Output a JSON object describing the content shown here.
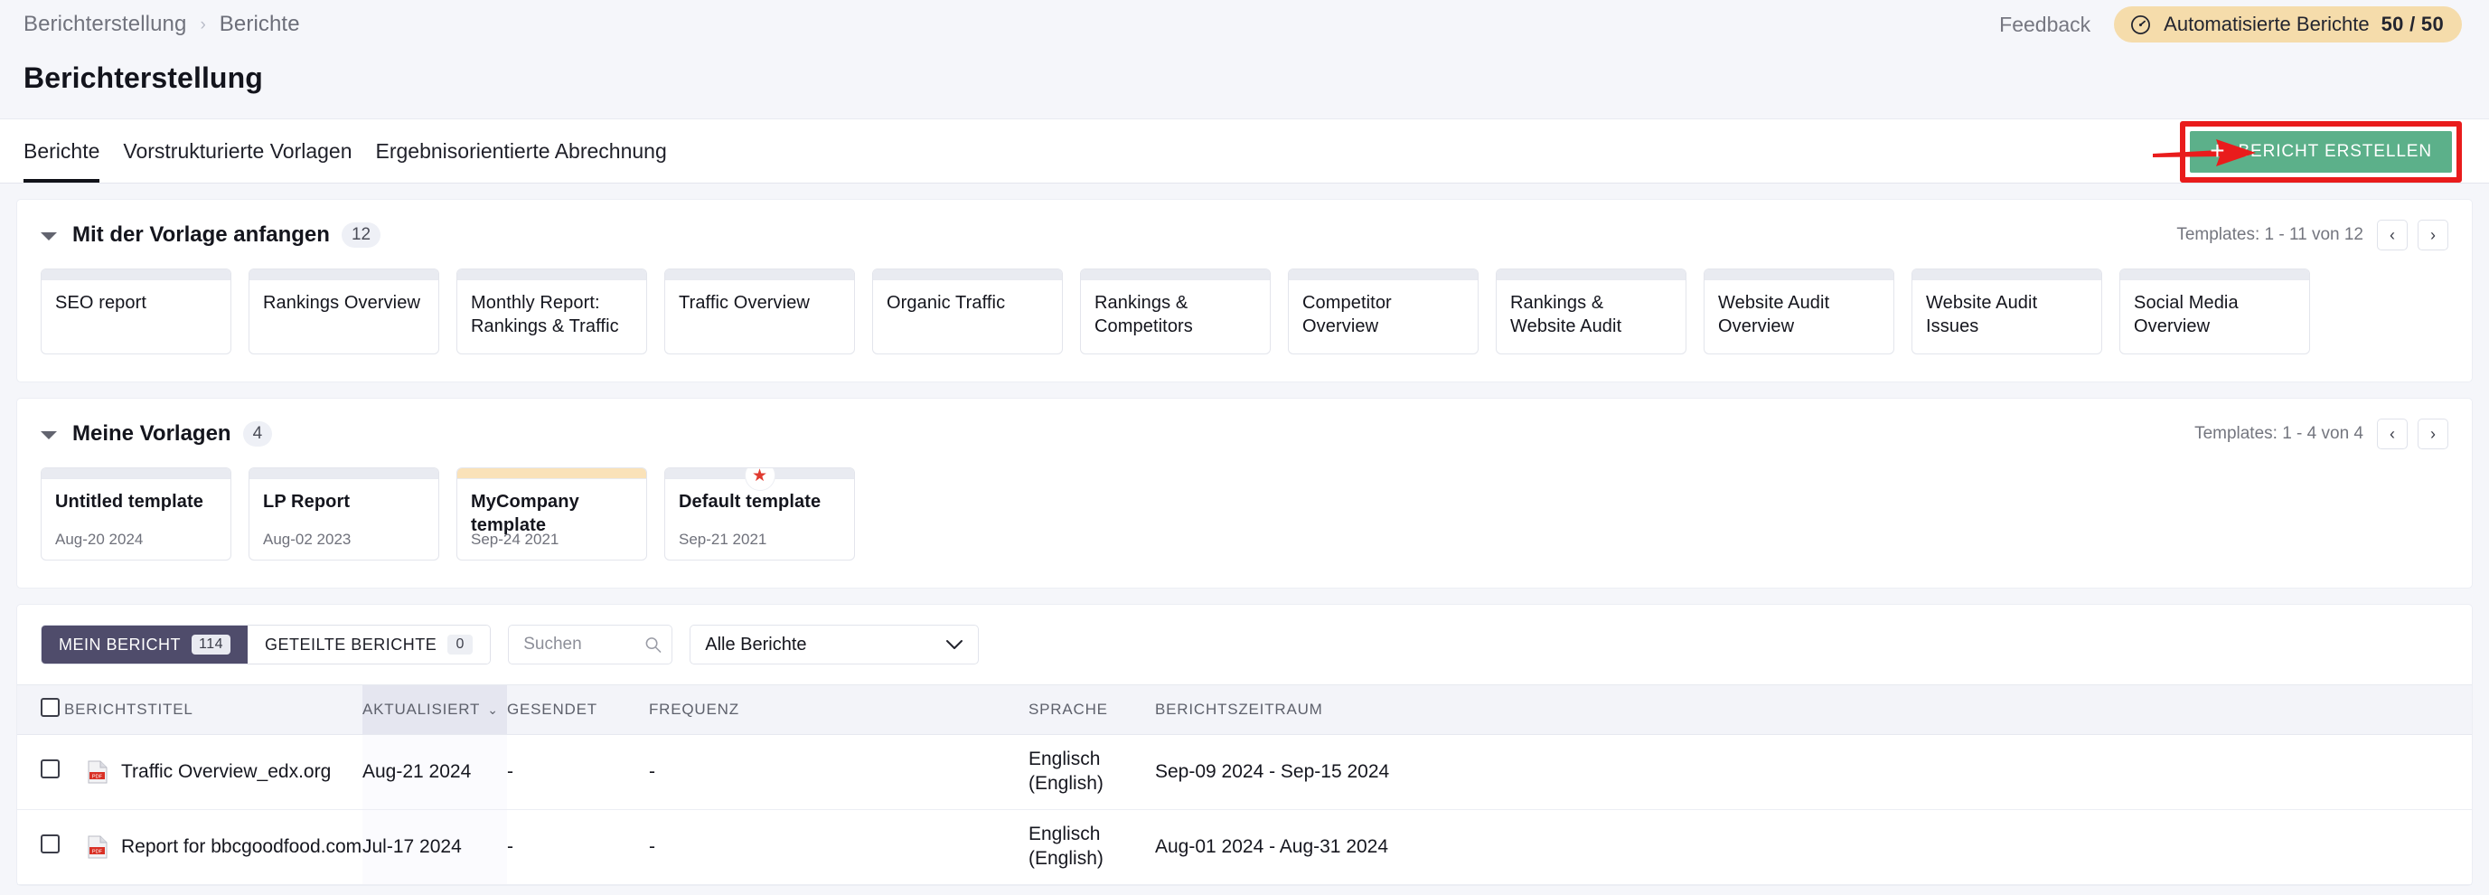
{
  "topbar": {
    "breadcrumb": [
      "Berichterstellung",
      "Berichte"
    ],
    "separator": "›",
    "feedback": "Feedback",
    "auto_reports_label": "Automatisierte Berichte",
    "auto_reports_count": "50 / 50",
    "badge_color": "#f5dcab"
  },
  "page": {
    "title": "Berichterstellung"
  },
  "tabs": [
    {
      "label": "Berichte",
      "active": true
    },
    {
      "label": "Vorstrukturierte Vorlagen",
      "active": false
    },
    {
      "label": "Ergebnisorientierte Abrechnung",
      "active": false
    }
  ],
  "create_button": {
    "label": "BERICHT ERSTELLEN",
    "plus": "+",
    "color": "#5cb08a",
    "highlight_color": "#e91c1c"
  },
  "sections": {
    "templates": {
      "title": "Mit der Vorlage anfangen",
      "count": "12",
      "pager_text": "Templates: 1 - 11 von 12",
      "prev": "‹",
      "next": "›",
      "cards": [
        {
          "title": "SEO report"
        },
        {
          "title": "Rankings Overview"
        },
        {
          "title": "Monthly Report: Rankings & Traffic"
        },
        {
          "title": "Traffic Overview"
        },
        {
          "title": "Organic Traffic"
        },
        {
          "title": "Rankings & Competitors"
        },
        {
          "title": "Competitor Overview"
        },
        {
          "title": "Rankings & Website Audit"
        },
        {
          "title": "Website Audit Overview"
        },
        {
          "title": "Website Audit Issues"
        },
        {
          "title": "Social Media Overview"
        }
      ]
    },
    "my_templates": {
      "title": "Meine Vorlagen",
      "count": "4",
      "pager_text": "Templates: 1 - 4 von 4",
      "prev": "‹",
      "next": "›",
      "cards": [
        {
          "title": "Untitled template",
          "date": "Aug-20 2024",
          "strip": "gray",
          "starred": false
        },
        {
          "title": "LP Report",
          "date": "Aug-02 2023",
          "strip": "gray",
          "starred": false
        },
        {
          "title": "MyCompany template",
          "date": "Sep-24 2021",
          "strip": "orange",
          "starred": false
        },
        {
          "title": "Default template",
          "date": "Sep-21 2021",
          "strip": "gray",
          "starred": true
        }
      ]
    }
  },
  "reports": {
    "segments": [
      {
        "label": "MEIN BERICHT",
        "count": "114",
        "active": true
      },
      {
        "label": "GETEILTE BERICHTE",
        "count": "0",
        "active": false
      }
    ],
    "search_placeholder": "Suchen",
    "search_value": "",
    "filter_selected": "Alle Berichte",
    "columns": [
      "BERICHTSTITEL",
      "AKTUALISIERT",
      "GESENDET",
      "FREQUENZ",
      "SPRACHE",
      "BERICHTSZEITRAUM"
    ],
    "sorted_column": "AKTUALISIERT",
    "rows": [
      {
        "title": "Traffic Overview_edx.org",
        "updated": "Aug-21 2024",
        "sent": "-",
        "frequency": "-",
        "language_line1": "Englisch",
        "language_line2": "(English)",
        "period": "Sep-09 2024 - Sep-15 2024"
      },
      {
        "title": "Report for bbcgoodfood.com",
        "updated": "Jul-17 2024",
        "sent": "-",
        "frequency": "-",
        "language_line1": "Englisch",
        "language_line2": "(English)",
        "period": "Aug-01 2024 - Aug-31 2024"
      }
    ]
  }
}
